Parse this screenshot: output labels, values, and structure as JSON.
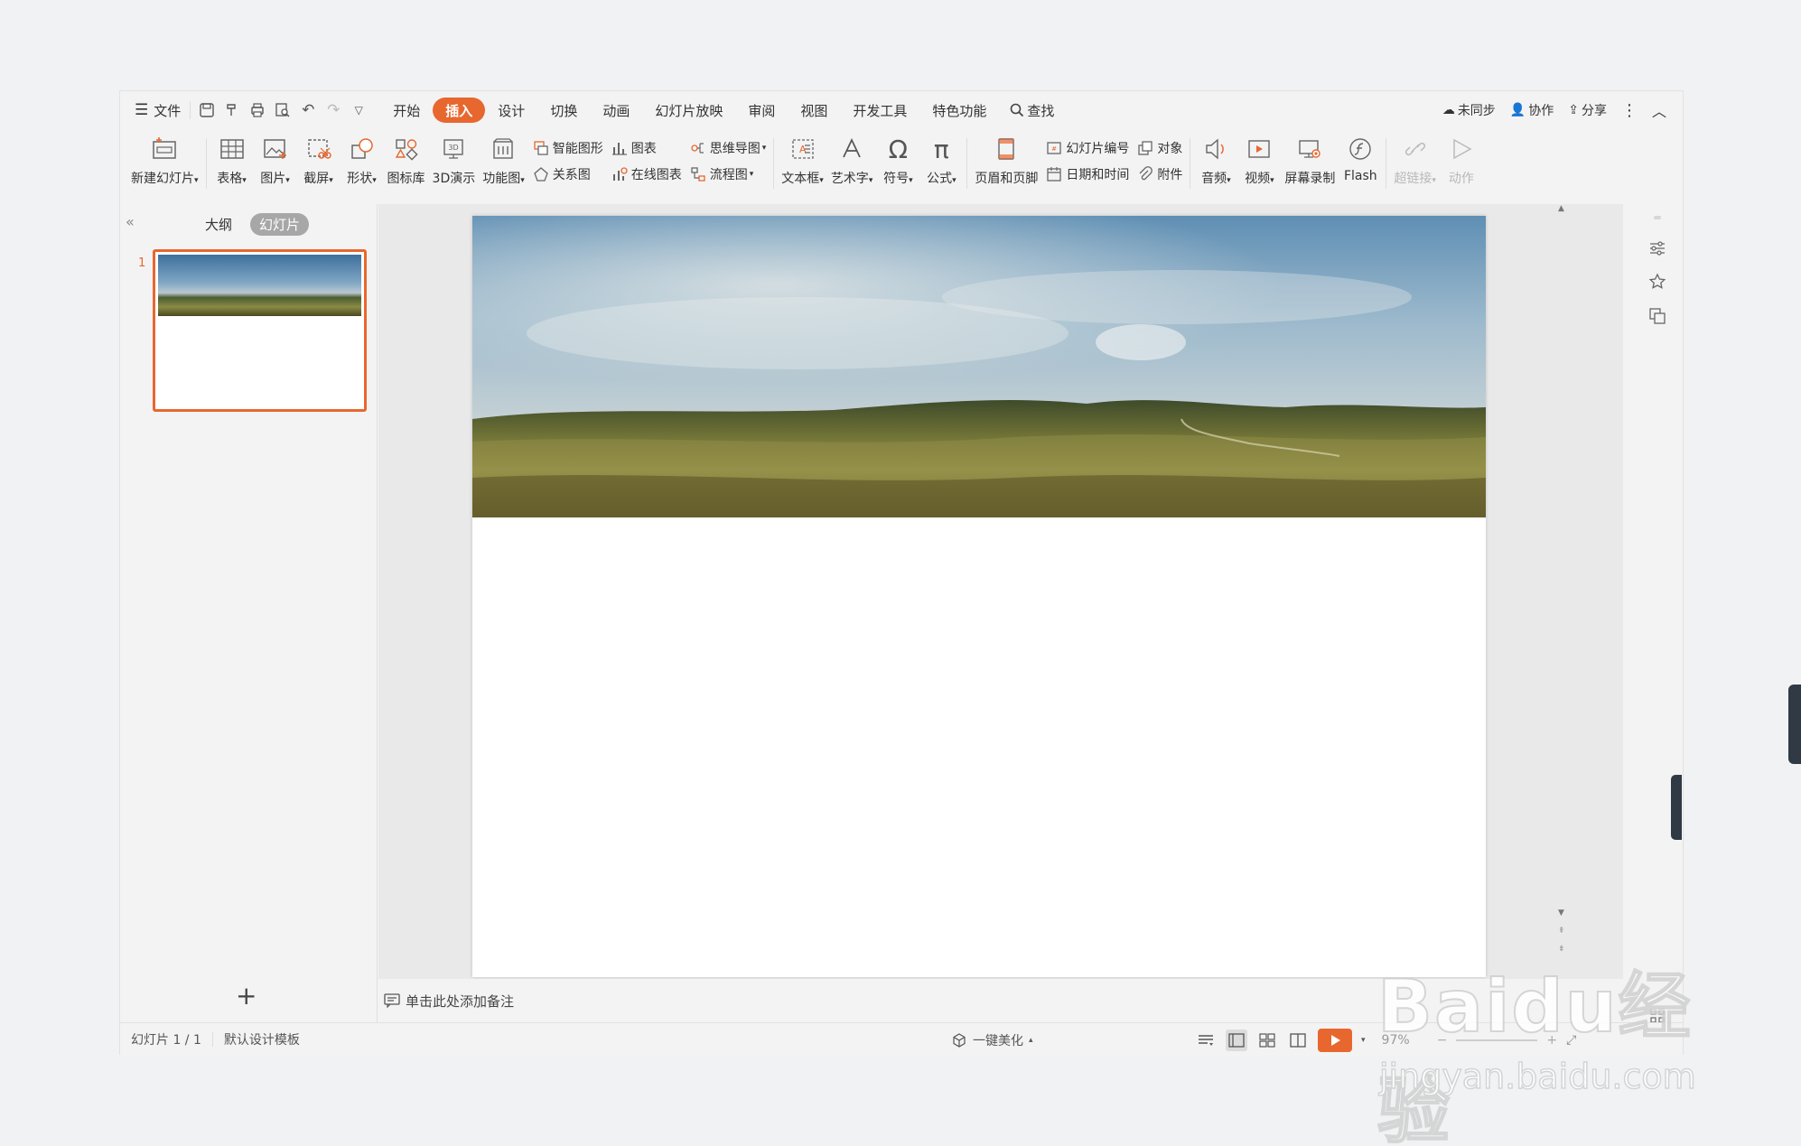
{
  "menubar": {
    "file": "文件",
    "tabs": [
      "开始",
      "插入",
      "设计",
      "切换",
      "动画",
      "幻灯片放映",
      "审阅",
      "视图",
      "开发工具",
      "特色功能"
    ],
    "active_tab": "插入",
    "search": "查找",
    "sync": "未同步",
    "collab": "协作",
    "share": "分享"
  },
  "ribbon": {
    "new_slide": "新建幻灯片",
    "table": "表格",
    "picture": "图片",
    "screenshot": "截屏",
    "shape": "形状",
    "icon_lib": "图标库",
    "threed": "3D演示",
    "func_chart": "功能图",
    "smart_art": "智能图形",
    "chart": "图表",
    "mind_map": "思维导图",
    "relation": "关系图",
    "online_chart": "在线图表",
    "flowchart": "流程图",
    "textbox": "文本框",
    "wordart": "艺术字",
    "symbol": "符号",
    "formula": "公式",
    "header_footer": "页眉和页脚",
    "slide_number": "幻灯片编号",
    "object": "对象",
    "date_time": "日期和时间",
    "attachment": "附件",
    "audio": "音频",
    "video": "视频",
    "screen_record": "屏幕录制",
    "flash": "Flash",
    "hyperlink": "超链接",
    "action": "动作"
  },
  "leftpanel": {
    "outline_tab": "大纲",
    "slides_tab": "幻灯片",
    "thumb_number": "1"
  },
  "notes": {
    "placeholder": "单击此处添加备注"
  },
  "statusbar": {
    "slide_info": "幻灯片 1 / 1",
    "template": "默认设计模板",
    "beautify": "一键美化",
    "zoom": "97%"
  },
  "watermark": {
    "logo": "Baidu经验",
    "url": "jingyan.baidu.com"
  },
  "colors": {
    "accent": "#e8672f"
  }
}
